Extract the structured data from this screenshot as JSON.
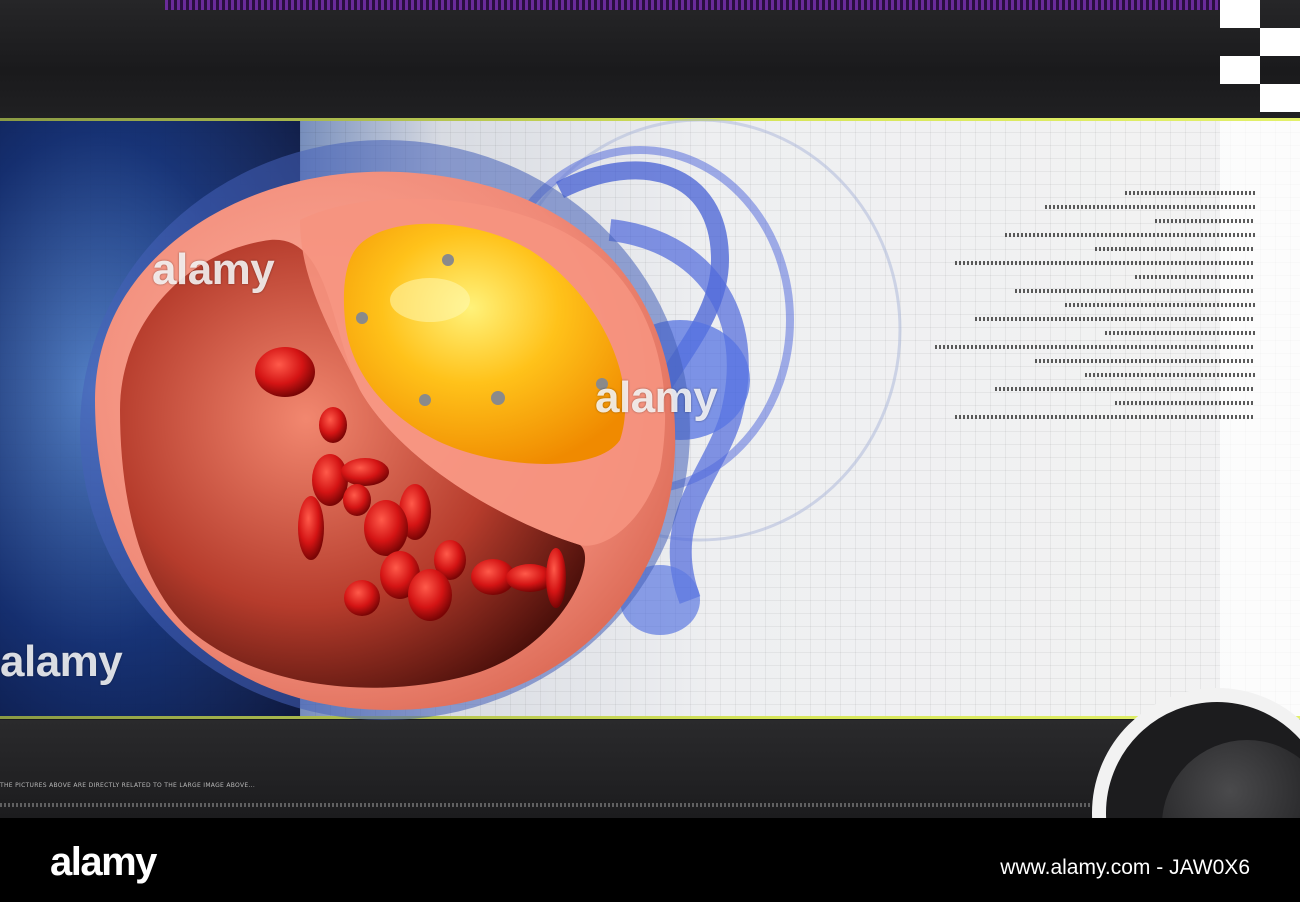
{
  "watermarks": {
    "left": "alamy",
    "center_top": "alamy",
    "center_right": "alamy",
    "bottom_left": "alamy"
  },
  "bottom_caption": "THE PICTURES ABOVE ARE DIRECTLY RELATED TO THE LARGE IMAGE ABOVE...",
  "footer": {
    "logo": "alamy",
    "image_id_url": "www.alamy.com - JAW0X6"
  },
  "colors": {
    "vessel_wall": "#f08a78",
    "plaque": "#ffc21a",
    "blood_cell": "#d41414",
    "accent_yellow": "#d7e65a",
    "purple_strip": "#6a2b9a"
  }
}
